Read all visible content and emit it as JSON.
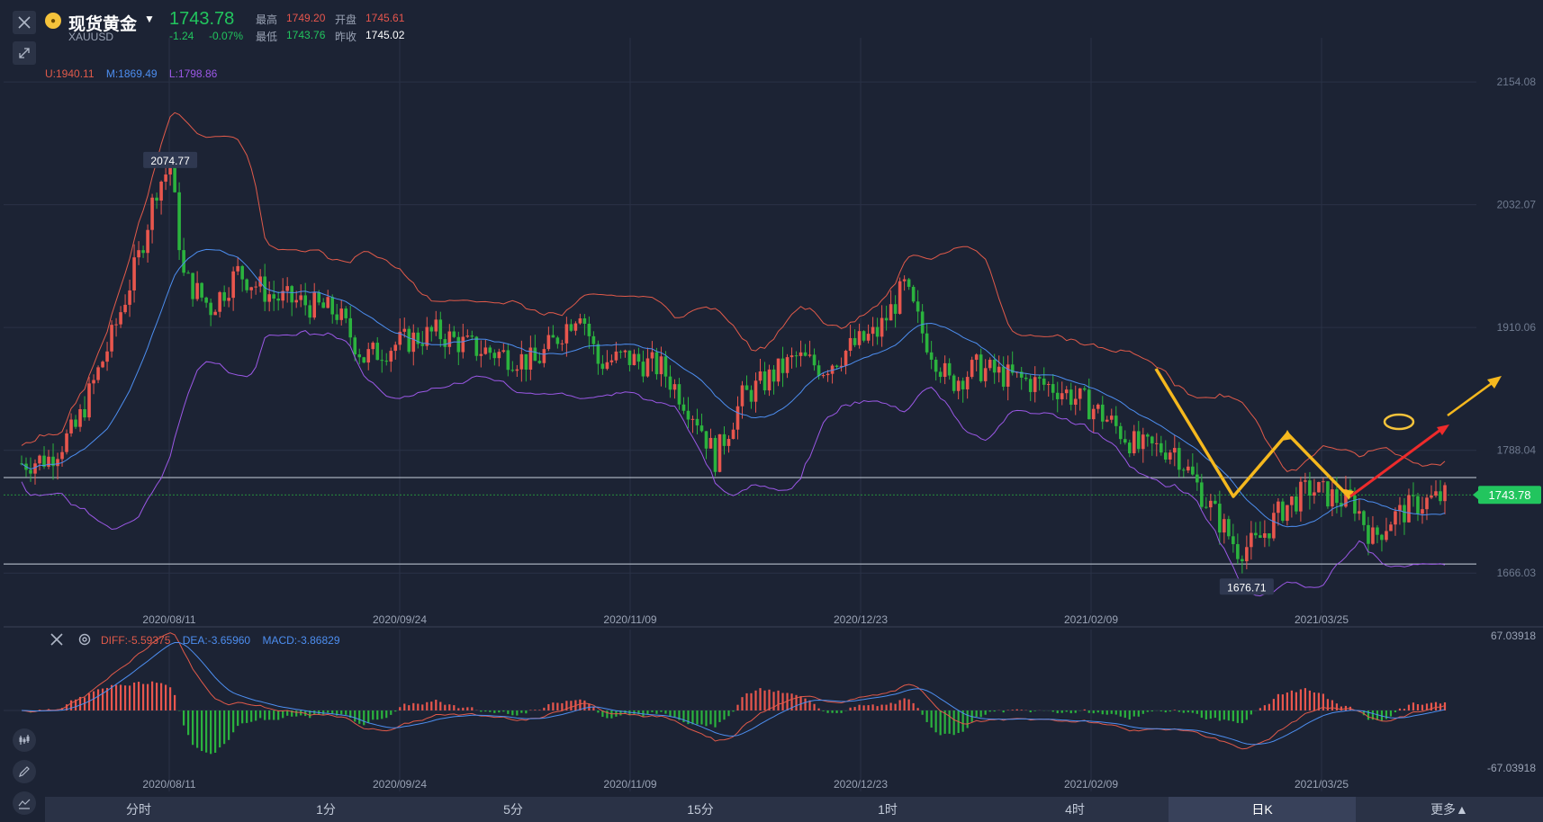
{
  "header": {
    "name": "现货黄金",
    "code": "XAUUSD",
    "last": "1743.78",
    "change": "-1.24",
    "change_pct": "-0.07%",
    "high_label": "最高",
    "high": "1749.20",
    "open_label": "开盘",
    "open": "1745.61",
    "low_label": "最低",
    "low": "1743.76",
    "prev_label": "昨收",
    "prev": "1745.02"
  },
  "legend": {
    "upper": "U:1940.11",
    "middle": "M:1869.49",
    "lower": "L:1798.86"
  },
  "macd_legend": {
    "diff": "DIFF:-5.59375",
    "dea": "DEA:-3.65960",
    "macd": "MACD:-3.86829"
  },
  "tabs": [
    "分时",
    "1分",
    "5分",
    "15分",
    "1时",
    "4时",
    "日K",
    "更多▲"
  ],
  "active_tab": 6,
  "colors": {
    "up": "#e8564d",
    "down": "#2bb33e",
    "upper": "#e05a4a",
    "middle": "#4d8ef0",
    "lower": "#9b58e6",
    "arrow_yellow": "#f5b81e",
    "arrow_red": "#ee2b2b"
  },
  "chart_data": {
    "type": "candlestick",
    "main": {
      "ylim": [
        1626,
        2198
      ],
      "yticks": [
        2154.08,
        2032.07,
        1910.06,
        1788.04,
        1666.03
      ],
      "ytick_labels": [
        "2154.08",
        "2032.07",
        "1910.06",
        "1788.04",
        "1666.03"
      ],
      "xtick_labels": [
        "2020/08/11",
        "2020/09/24",
        "2020/11/09",
        "2020/12/23",
        "2021/02/09",
        "2021/03/25"
      ],
      "current_price": 1743.78,
      "current_price_label": "1743.78",
      "max_label": "2074.77",
      "max_value": 2074.77,
      "min_label": "1676.71",
      "min_value": 1676.71,
      "hlines": [
        1761,
        1675
      ],
      "series_overlays": [
        "upper",
        "middle",
        "lower"
      ]
    },
    "sub": {
      "ylim": [
        -67.03918,
        67.03918
      ],
      "ytick_labels": [
        "67.03918",
        "-67.03918"
      ],
      "xtick_labels": [
        "2020/08/11",
        "2020/09/24",
        "2020/11/09",
        "2020/12/23",
        "2021/02/09",
        "2021/03/25"
      ],
      "series": [
        "DIFF",
        "DEA",
        "MACD"
      ]
    }
  }
}
